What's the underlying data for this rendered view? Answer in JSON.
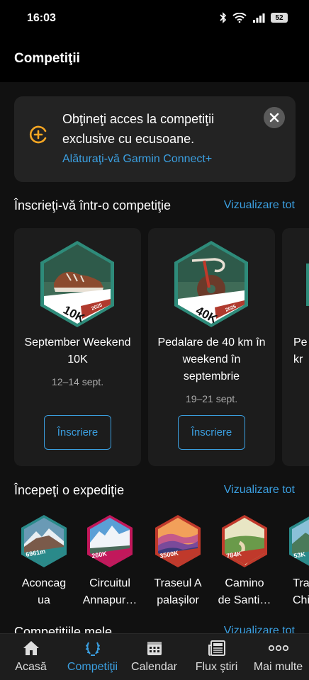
{
  "status_bar": {
    "time": "16:03",
    "battery": "52"
  },
  "header": {
    "title": "Competiţii"
  },
  "promo": {
    "title": "Obţineţi acces la competiţii exclusive cu ecusoane.",
    "link": "Alăturaţi-vă Garmin Connect+"
  },
  "competitions_section": {
    "title": "Înscrieţi-vă într-o competiţie",
    "view_all": "Vizualizare tot",
    "cards": [
      {
        "badge_text": "10K",
        "badge_year": "2025",
        "name": "September Weekend 10K",
        "date": "12–14 sept.",
        "button": "Înscriere"
      },
      {
        "badge_text": "40K",
        "badge_year": "2025",
        "name": "Pedalare de 40 km în weekend în septembrie",
        "date": "19–21 sept.",
        "button": "Înscriere"
      },
      {
        "name_partial": "Pe\nkr"
      }
    ]
  },
  "expeditions_section": {
    "title": "Începeţi o expediţie",
    "view_all": "Vizualizare tot",
    "items": [
      {
        "badge_text": "6961m",
        "name": "Aconcag\nua",
        "color": "#2a8a8a"
      },
      {
        "badge_text": "260K",
        "name": "Circuitul\nAnnapur…",
        "color": "#c2185b"
      },
      {
        "badge_text": "3500K",
        "name": "Traseul A\npalaşilor",
        "color": "#c0392b"
      },
      {
        "badge_text": "784K",
        "name": "Camino\nde Santi…",
        "color": "#c0392b"
      },
      {
        "badge_text": "53K",
        "name": "Tra\nChi",
        "color": "#2a8a8a"
      }
    ]
  },
  "my_competitions": {
    "title": "Competiţiile mele",
    "view_all": "Vizualizare tot"
  },
  "bottom_nav": {
    "items": [
      {
        "label": "Acasă",
        "icon": "home-icon"
      },
      {
        "label": "Competiţii",
        "icon": "laurel-icon"
      },
      {
        "label": "Calendar",
        "icon": "calendar-icon"
      },
      {
        "label": "Flux ştiri",
        "icon": "news-icon"
      },
      {
        "label": "Mai multe",
        "icon": "more-icon"
      }
    ]
  },
  "colors": {
    "accent": "#3b9fe0",
    "promo_icon": "#f5a623",
    "card_bg": "#1c1c1c"
  }
}
